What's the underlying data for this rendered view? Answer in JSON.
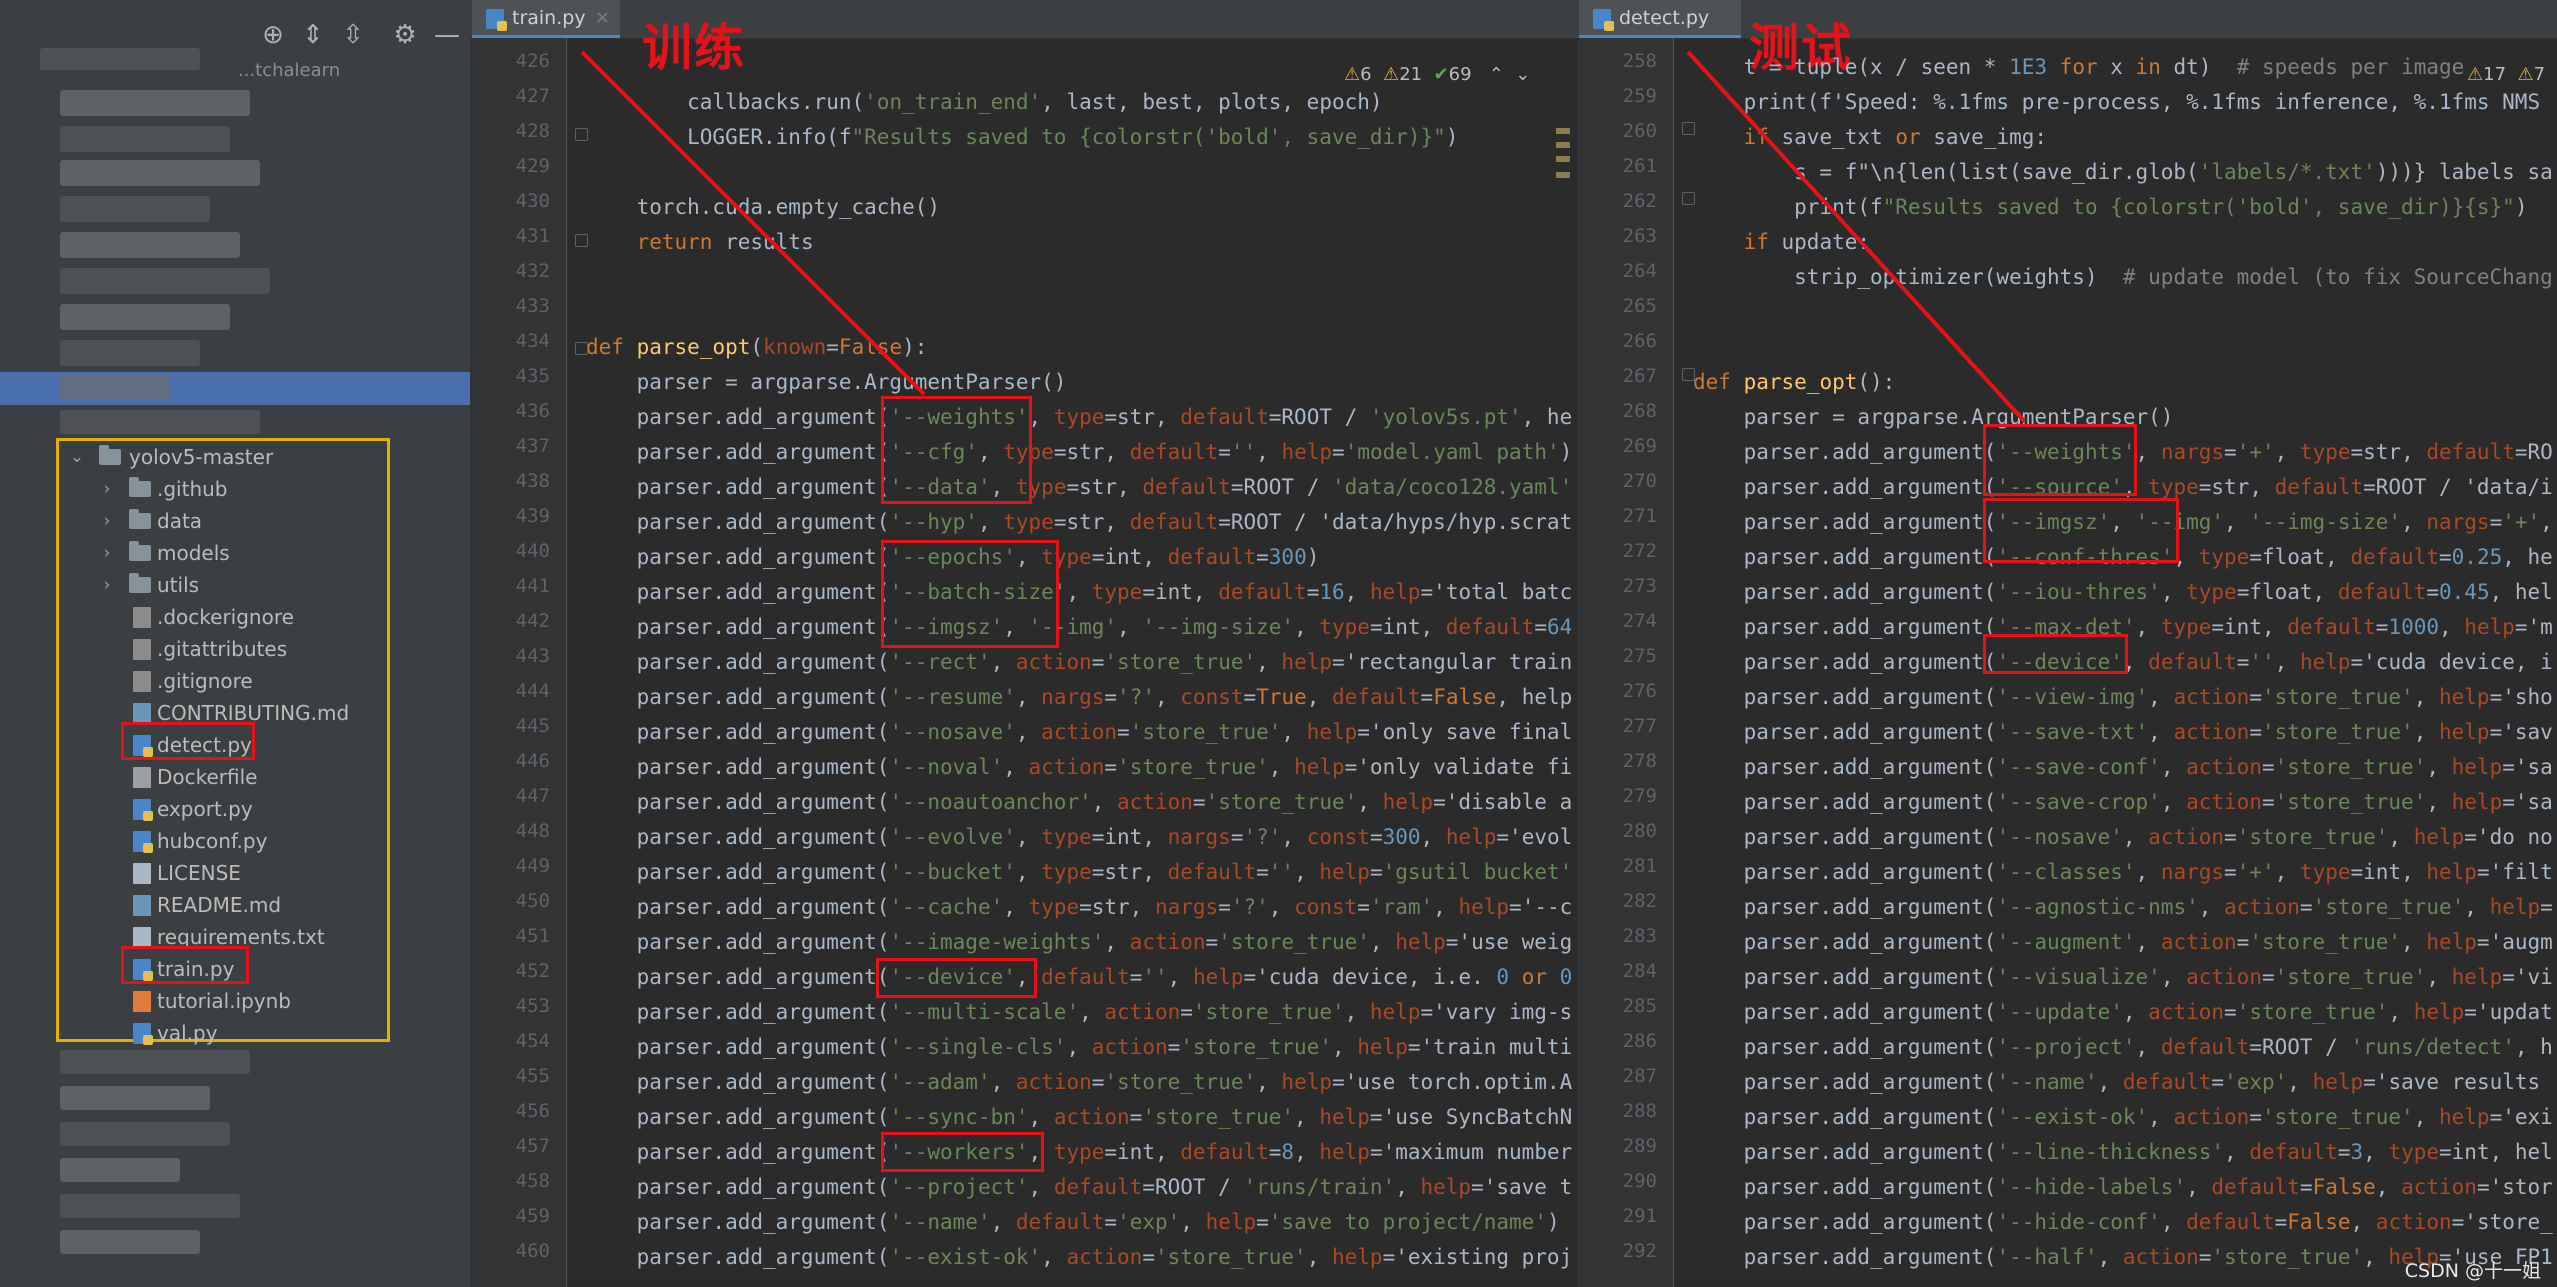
{
  "project_panel": {
    "top_truncated_label": "...tchalearn",
    "toolbar_icons": [
      "locate-icon",
      "expand-all-icon",
      "collapse-all-icon",
      "gear-icon",
      "minimize-icon"
    ],
    "root_folder": "yolov5-master",
    "folders": [
      ".github",
      "data",
      "models",
      "utils"
    ],
    "files": [
      ".dockerignore",
      ".gitattributes",
      ".gitignore",
      "CONTRIBUTING.md",
      "detect.py",
      "Dockerfile",
      "export.py",
      "hubconf.py",
      "LICENSE",
      "README.md",
      "requirements.txt",
      "train.py",
      "tutorial.ipynb",
      "val.py"
    ]
  },
  "left_editor": {
    "tab_label": "train.py",
    "annotation_label": "训练",
    "inspections": {
      "warnings": "6",
      "weak_warnings": "21",
      "ok": "69"
    },
    "line_numbers": [
      "426",
      "427",
      "428",
      "429",
      "430",
      "431",
      "432",
      "433",
      "434",
      "435",
      "436",
      "437",
      "438",
      "439",
      "440",
      "441",
      "442",
      "443",
      "444",
      "445",
      "446",
      "447",
      "448",
      "449",
      "450",
      "451",
      "452",
      "453",
      "454",
      "455",
      "456",
      "457",
      "458",
      "459",
      "460"
    ],
    "code_lines": [
      "",
      "        callbacks.run('on_train_end', last, best, plots, epoch)",
      "        LOGGER.info(f\"Results saved to {colorstr('bold', save_dir)}\")",
      "",
      "    torch.cuda.empty_cache()",
      "    return results",
      "",
      "",
      "def parse_opt(known=False):",
      "    parser = argparse.ArgumentParser()",
      "    parser.add_argument('--weights', type=str, default=ROOT / 'yolov5s.pt', he",
      "    parser.add_argument('--cfg', type=str, default='', help='model.yaml path')",
      "    parser.add_argument('--data', type=str, default=ROOT / 'data/coco128.yaml'",
      "    parser.add_argument('--hyp', type=str, default=ROOT / 'data/hyps/hyp.scrat",
      "    parser.add_argument('--epochs', type=int, default=300)",
      "    parser.add_argument('--batch-size', type=int, default=16, help='total batc",
      "    parser.add_argument('--imgsz', '--img', '--img-size', type=int, default=64",
      "    parser.add_argument('--rect', action='store_true', help='rectangular train",
      "    parser.add_argument('--resume', nargs='?', const=True, default=False, help",
      "    parser.add_argument('--nosave', action='store_true', help='only save final",
      "    parser.add_argument('--noval', action='store_true', help='only validate fi",
      "    parser.add_argument('--noautoanchor', action='store_true', help='disable a",
      "    parser.add_argument('--evolve', type=int, nargs='?', const=300, help='evol",
      "    parser.add_argument('--bucket', type=str, default='', help='gsutil bucket'",
      "    parser.add_argument('--cache', type=str, nargs='?', const='ram', help='--c",
      "    parser.add_argument('--image-weights', action='store_true', help='use weig",
      "    parser.add_argument('--device', default='', help='cuda device, i.e. 0 or 0",
      "    parser.add_argument('--multi-scale', action='store_true', help='vary img-s",
      "    parser.add_argument('--single-cls', action='store_true', help='train multi",
      "    parser.add_argument('--adam', action='store_true', help='use torch.optim.A",
      "    parser.add_argument('--sync-bn', action='store_true', help='use SyncBatchN",
      "    parser.add_argument('--workers', type=int, default=8, help='maximum number",
      "    parser.add_argument('--project', default=ROOT / 'runs/train', help='save t",
      "    parser.add_argument('--name', default='exp', help='save to project/name')",
      "    parser.add_argument('--exist-ok', action='store_true', help='existing proj"
    ]
  },
  "right_editor": {
    "tab_label": "detect.py",
    "annotation_label": "测试",
    "inspections": {
      "warnings": "17",
      "weak_warnings": "7"
    },
    "line_numbers": [
      "258",
      "259",
      "260",
      "261",
      "262",
      "263",
      "264",
      "265",
      "266",
      "267",
      "268",
      "269",
      "270",
      "271",
      "272",
      "273",
      "274",
      "275",
      "276",
      "277",
      "278",
      "279",
      "280",
      "281",
      "282",
      "283",
      "284",
      "285",
      "286",
      "287",
      "288",
      "289",
      "290",
      "291",
      "292"
    ],
    "code_lines": [
      "    t = tuple(x / seen * 1E3 for x in dt)  # speeds per image",
      "    print(f'Speed: %.1fms pre-process, %.1fms inference, %.1fms NMS",
      "    if save_txt or save_img:",
      "        s = f\"\\n{len(list(save_dir.glob('labels/*.txt')))} labels sa",
      "        print(f\"Results saved to {colorstr('bold', save_dir)}{s}\")",
      "    if update:",
      "        strip_optimizer(weights)  # update model (to fix SourceChang",
      "",
      "",
      "def parse_opt():",
      "    parser = argparse.ArgumentParser()",
      "    parser.add_argument('--weights', nargs='+', type=str, default=RO",
      "    parser.add_argument('--source', type=str, default=ROOT / 'data/i",
      "    parser.add_argument('--imgsz', '--img', '--img-size', nargs='+',",
      "    parser.add_argument('--conf-thres', type=float, default=0.25, he",
      "    parser.add_argument('--iou-thres', type=float, default=0.45, hel",
      "    parser.add_argument('--max-det', type=int, default=1000, help='m",
      "    parser.add_argument('--device', default='', help='cuda device, i",
      "    parser.add_argument('--view-img', action='store_true', help='sho",
      "    parser.add_argument('--save-txt', action='store_true', help='sav",
      "    parser.add_argument('--save-conf', action='store_true', help='sa",
      "    parser.add_argument('--save-crop', action='store_true', help='sa",
      "    parser.add_argument('--nosave', action='store_true', help='do no",
      "    parser.add_argument('--classes', nargs='+', type=int, help='filt",
      "    parser.add_argument('--agnostic-nms', action='store_true', help=",
      "    parser.add_argument('--augment', action='store_true', help='augm",
      "    parser.add_argument('--visualize', action='store_true', help='vi",
      "    parser.add_argument('--update', action='store_true', help='updat",
      "    parser.add_argument('--project', default=ROOT / 'runs/detect', h",
      "    parser.add_argument('--name', default='exp', help='save results",
      "    parser.add_argument('--exist-ok', action='store_true', help='exi",
      "    parser.add_argument('--line-thickness', default=3, type=int, hel",
      "    parser.add_argument('--hide-labels', default=False, action='stor",
      "    parser.add_argument('--hide-conf', default=False, action='store_",
      "    parser.add_argument('--half', action='store_true', help='use FP1"
    ]
  },
  "watermark": "CSDN @十一姐",
  "colors": {
    "annotation": "#e5121a",
    "tree_box": "#e1b000",
    "selection": "#4b6eaf"
  }
}
